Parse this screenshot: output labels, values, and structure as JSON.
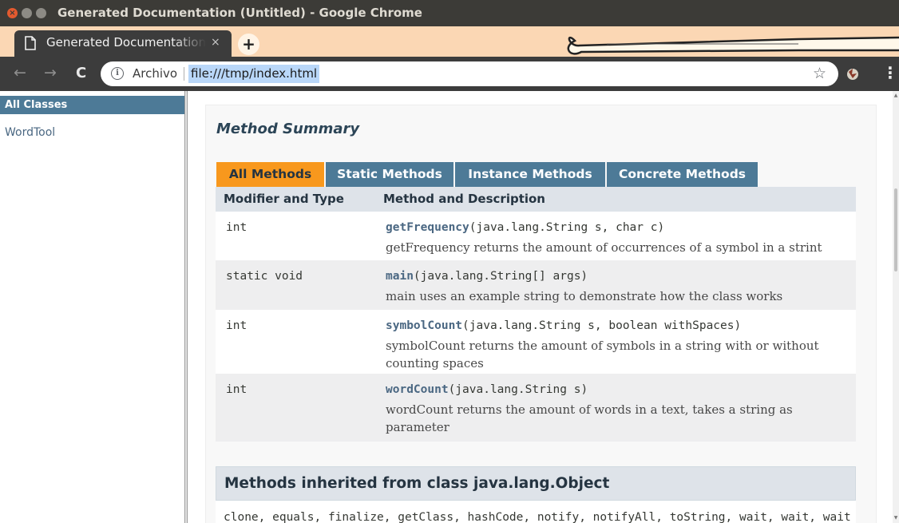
{
  "window": {
    "title": "Generated Documentation (Untitled) - Google Chrome"
  },
  "tab": {
    "title": "Generated Documentation (Untitled)",
    "close": "×",
    "new_tab": "+"
  },
  "toolbar": {
    "back": "←",
    "forward": "→",
    "reload": "C",
    "origin_label": "Archivo",
    "url": "file:///tmp/index.html",
    "menu": "⋮"
  },
  "sidebar": {
    "heading": "All Classes",
    "classes": [
      "WordTool"
    ]
  },
  "summary": {
    "title": "Method Summary",
    "tabs": [
      {
        "label": "All Methods",
        "active": true
      },
      {
        "label": "Static Methods",
        "active": false
      },
      {
        "label": "Instance Methods",
        "active": false
      },
      {
        "label": "Concrete Methods",
        "active": false
      }
    ],
    "columns": {
      "type": "Modifier and Type",
      "method": "Method and Description"
    },
    "rows": [
      {
        "type": "int",
        "name": "getFrequency",
        "params": "(java.lang.String s, char c)",
        "description": "getFrequency returns the amount of occurrences of a symbol in a strint"
      },
      {
        "type": "static void",
        "name": "main",
        "params": "(java.lang.String[] args)",
        "description": "main uses an example string to demonstrate how the class works"
      },
      {
        "type": "int",
        "name": "symbolCount",
        "params": "(java.lang.String s, boolean withSpaces)",
        "description": "symbolCount returns the amount of symbols in a string with or without counting spaces"
      },
      {
        "type": "int",
        "name": "wordCount",
        "params": "(java.lang.String s)",
        "description": "wordCount returns the amount of words in a text, takes a string as parameter"
      }
    ]
  },
  "inherited": {
    "title": "Methods inherited from class java.lang.Object",
    "methods": "clone, equals, finalize, getClass, hashCode, notify, notifyAll, toString, wait, wait, wait"
  },
  "colors": {
    "nav_blue": "#4d7a97",
    "active_tab_orange": "#f8981d",
    "header_gray": "#dee3e9",
    "link_blue": "#4a6782"
  }
}
